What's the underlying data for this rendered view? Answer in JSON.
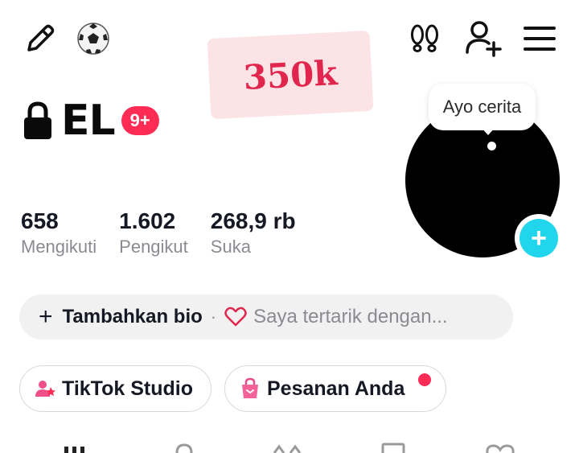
{
  "header": {
    "icons": [
      "edit-pencil-icon",
      "soccer-ball-icon",
      "footprints-icon",
      "add-user-icon",
      "hamburger-menu-icon"
    ]
  },
  "sticker": {
    "text": "350k",
    "color": "#e0264d",
    "background": "#fbe3e6"
  },
  "profile": {
    "name": "EL",
    "notification_badge": "9+",
    "story_bubble": "Ayo cerita"
  },
  "stats": [
    {
      "value": "658",
      "label": "Mengikuti"
    },
    {
      "value": "1.602",
      "label": "Pengikut"
    },
    {
      "value": "268,9 rb",
      "label": "Suka"
    }
  ],
  "bio": {
    "add_label": "Tambahkan bio",
    "separator": "·",
    "interest_placeholder": "Saya tertarik dengan..."
  },
  "shortcuts": [
    {
      "label": "TikTok Studio",
      "icon": "studio-icon"
    },
    {
      "label": "Pesanan Anda",
      "icon": "shopping-bag-icon",
      "has_notification": true
    }
  ],
  "colors": {
    "accent": "#fe2c55",
    "add_button": "#20d5ec"
  }
}
